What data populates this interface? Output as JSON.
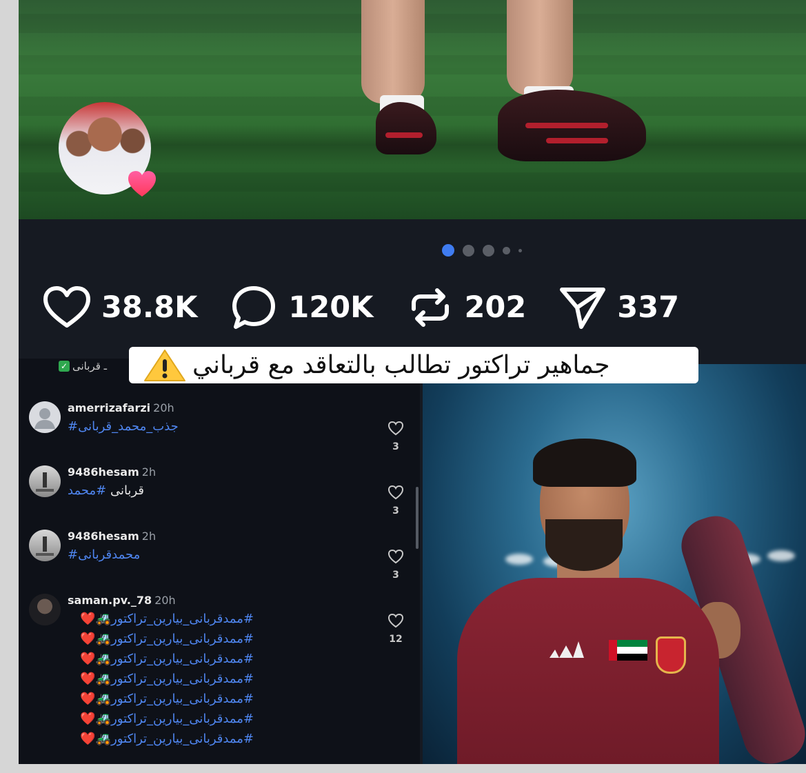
{
  "post": {
    "carousel_dots": 5,
    "active_dot": 0,
    "stats": {
      "likes": "38.8K",
      "comments": "120K",
      "reposts": "202",
      "shares": "337"
    }
  },
  "headline": {
    "text": "جماهير تراكتور تطالب بالتعاقد مع قرباني"
  },
  "comments_section": {
    "partial_top_text": "ـ قربانی",
    "items": [
      {
        "username": "amerrizafarzi",
        "time": "20h",
        "body": "#جذب_محمد_قربانی",
        "likes": "3"
      },
      {
        "username": "9486hesam",
        "time": "2h",
        "body_hashtag": "#محمد",
        "body_plain": "قربانی",
        "likes": "3"
      },
      {
        "username": "9486hesam",
        "time": "2h",
        "body": "#محمدقربانی",
        "likes": "3"
      },
      {
        "username": "saman.pv._78",
        "time": "20h",
        "lines": [
          "#ممدقربانی_بیارین_تراکتور🚜❤️",
          "#ممدقربانی_بیارین_تراکتور🚜❤️",
          "#ممدقربانی_بیارین_تراکتور🚜❤️",
          "#ممدقربانی_بیارین_تراکتور🚜❤️",
          "#ممدقربانی_بیارین_تراکتور🚜❤️",
          "#ممدقربانی_بیارین_تراکتور🚜❤️",
          "#ممدقربانی_بیارین_تراکتور🚜❤️"
        ],
        "likes": "12"
      }
    ]
  },
  "colors": {
    "background": "#161a22",
    "active_dot": "#3f7cf1",
    "hashtag": "#4f86f0",
    "jersey": "#8a2433"
  },
  "icons": [
    "heart-icon",
    "comment-icon",
    "repost-icon",
    "share-icon",
    "warning-icon",
    "like-heart-icon",
    "verified-check-icon"
  ]
}
